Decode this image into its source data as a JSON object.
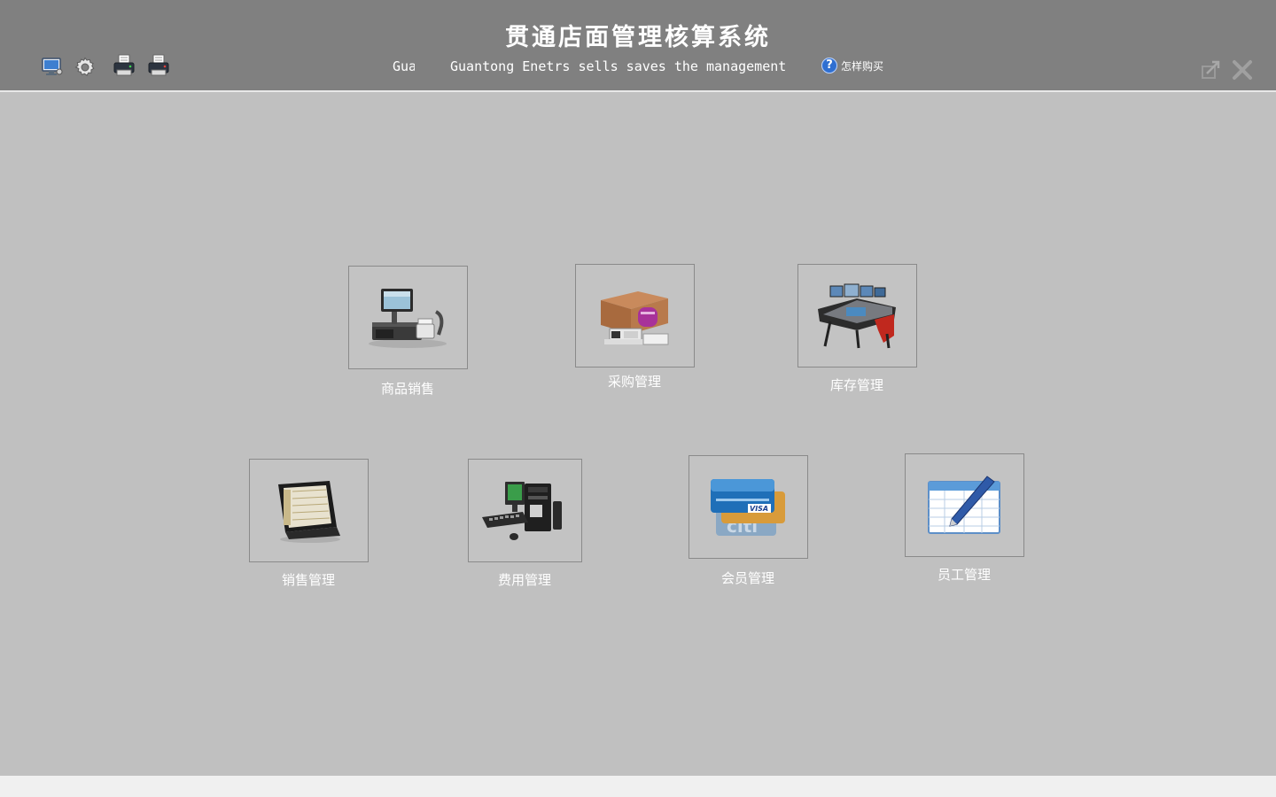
{
  "header": {
    "title": "贯通店面管理核算系统",
    "marquee_fragment": "Gua",
    "subtitle": "Guantong Enetrs sells saves the management",
    "help_label": "怎样购买",
    "help_badge": "?",
    "toolbar": [
      {
        "name": "monitor-settings-icon"
      },
      {
        "name": "gear-icon"
      },
      {
        "name": "printer-icon"
      },
      {
        "name": "fax-printer-icon"
      }
    ],
    "window_controls": [
      {
        "name": "restore-icon"
      },
      {
        "name": "close-icon"
      }
    ]
  },
  "modules": {
    "goods_sales": "商品销售",
    "purchase": "采购管理",
    "inventory": "库存管理",
    "sales": "销售管理",
    "expense": "费用管理",
    "member": "会员管理",
    "staff": "员工管理"
  },
  "colors": {
    "header_bg": "#808080",
    "body_bg": "#c0c0c0",
    "footer_bg": "#f0f0f0",
    "text": "#ffffff"
  }
}
